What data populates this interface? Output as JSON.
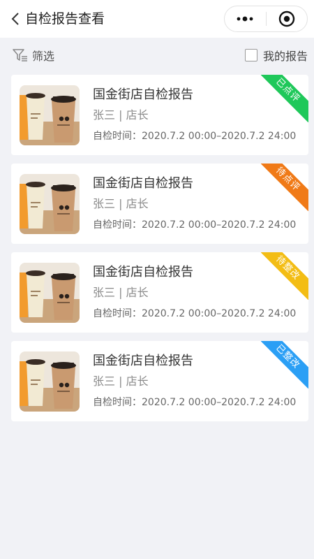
{
  "header": {
    "title": "自检报告查看",
    "back_icon": "chevron-left-icon",
    "more_icon": "more-dots-icon",
    "close_icon": "target-close-icon"
  },
  "toolbar": {
    "filter_label": "筛选",
    "filter_icon": "filter-icon",
    "my_report_label": "我的报告",
    "my_report_checked": false
  },
  "reports": [
    {
      "title": "国金街店自检报告",
      "person": "张三 | 店长",
      "time_label": "自检时间：",
      "time": "2020.7.2 00:00–2020.7.2 24:00",
      "status": "已点评",
      "status_color": "#1fc85a"
    },
    {
      "title": "国金街店自检报告",
      "person": "张三 | 店长",
      "time_label": "自检时间：",
      "time": "2020.7.2 00:00–2020.7.2 24:00",
      "status": "待点评",
      "status_color": "#f07a17"
    },
    {
      "title": "国金街店自检报告",
      "person": "张三 | 店长",
      "time_label": "自检时间：",
      "time": "2020.7.2 00:00–2020.7.2 24:00",
      "status": "待整改",
      "status_color": "#f3bd14"
    },
    {
      "title": "国金街店自检报告",
      "person": "张三 | 店长",
      "time_label": "自检时间：",
      "time": "2020.7.2 00:00–2020.7.2 24:00",
      "status": "已整改",
      "status_color": "#2b9ff5"
    }
  ]
}
